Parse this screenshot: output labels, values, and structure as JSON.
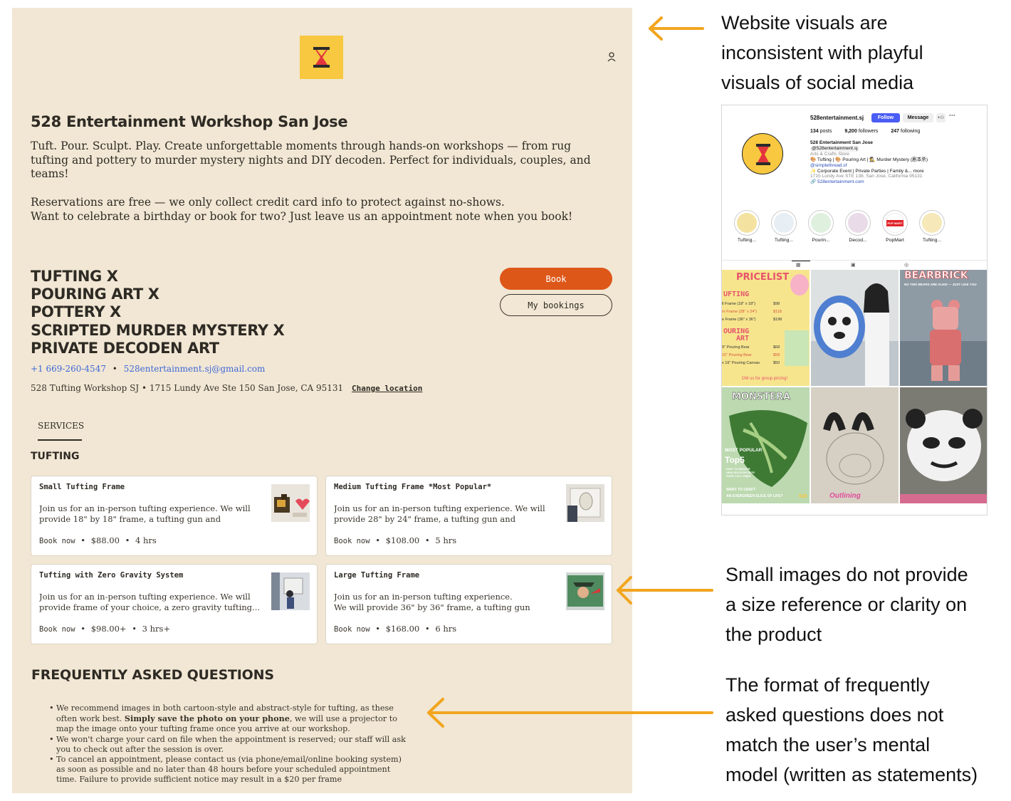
{
  "site": {
    "title": "528 Entertainment Workshop San Jose",
    "intro": "Tuft. Pour. Sculpt. Play. Create unforgettable moments through hands-on workshops — from rug tufting and pottery to murder mystery nights and DIY decoden. Perfect for individuals, couples, and teams!",
    "reservation_line1": "Reservations are free — we only collect credit card info to protect against no-shows.",
    "reservation_line2": "Want to celebrate a birthday or book for two? Just leave us an appointment note when you book!",
    "services_list": [
      "TUFTING X",
      "POURING ART X",
      "POTTERY X",
      "SCRIPTED MURDER MYSTERY X",
      "PRIVATE DECODEN ART"
    ],
    "book_label": "Book",
    "my_bookings_label": "My bookings",
    "phone": "+1 669-260-4547",
    "separator": "•",
    "email": "528entertainment.sj@gmail.com",
    "address": "528 Tufting Workshop SJ • 1715 Lundy Ave Ste 150 San Jose, CA 95131",
    "change_location": "Change location",
    "tab_services": "SERVICES",
    "category": "TUFTING",
    "cards": [
      {
        "title": "Small Tufting Frame",
        "desc": "Join us for an in-person tufting experience. We will provide 18\" by 18\" frame, a tufting gun and unlimited...",
        "book": "Book now",
        "price": "$88.00",
        "duration": "4 hrs"
      },
      {
        "title": "Medium Tufting Frame *Most Popular*",
        "desc": "Join us for an in-person tufting experience. We will provide 28\" by 24\" frame, a tufting gun and unlimited...",
        "book": "Book now",
        "price": "$108.00",
        "duration": "5 hrs"
      },
      {
        "title": "Tufting with Zero Gravity System",
        "desc": "Join us for an in-person tufting experience. We will provide frame of your choice, a zero gravity tufting...",
        "book": "Book now",
        "price": "$98.00+",
        "duration": "3 hrs+"
      },
      {
        "title": "Large Tufting Frame",
        "desc": "Join us for an in-person tufting experience.\nWe will provide 36\" by 36\" frame, a tufting gun and...",
        "book": "Book now",
        "price": "$168.00",
        "duration": "6 hrs"
      }
    ],
    "faq_title": "FREQUENTLY ASKED QUESTIONS",
    "faq": {
      "item1_a": "We recommend images in both cartoon-style and abstract-style for tufting, as these often work best. ",
      "item1_bold": "Simply save the photo on your phone",
      "item1_b": ", we will use a projector to map the image onto your tufting frame once you arrive at our workshop.",
      "item2": "We won't charge your card on file when the appointment is reserved; our staff will ask you to check out after the session is over.",
      "item3": "To cancel an appointment, please contact us (via phone/email/online booking system) as soon as possible and no later than 48 hours before your scheduled appointment time. Failure to provide sufficient notice may result in a $20 per frame"
    }
  },
  "annotations": {
    "a1": [
      "Website visuals are",
      "inconsistent with playful",
      "visuals of social media"
    ],
    "a2": [
      "Small images do not provide",
      "a size reference or clarity on",
      "the product"
    ],
    "a3": [
      "The format of frequently",
      "asked questions does not",
      "match the user’s mental",
      "model (written as statements)"
    ],
    "arrow_color": "#f2a51e"
  },
  "instagram": {
    "username": "528entertainment.sj",
    "follow": "Follow",
    "message": "Message",
    "add_icon": "+⚇",
    "more": "···",
    "posts_num": "134",
    "posts_lbl": "posts",
    "followers_num": "9,200",
    "followers_lbl": "followers",
    "following_num": "247",
    "following_lbl": "following",
    "name": "528 Entertainment San Jose",
    "handle": "@528entertainment.sj",
    "category": "Arts & Crafts Store",
    "bio1": "🎨 Tufting | 🎨 Pouring Art | 🕵 Murder Mystery (剧本杀)",
    "bio2": "@simplethread.sf",
    "bio3": "✨ Corporate Event | Private Parties | Family &... more",
    "bio4": "1715 Lundy Ave STE 138, San Jose, California 95131",
    "link": "🔗 528entertainment.com",
    "highlights": [
      "Tufting...",
      "Tufting...",
      "Pourin...",
      "Decod...",
      "PopMart",
      "Tufting..."
    ],
    "popmart_badge": "POP MART",
    "tab_icons": [
      "▦",
      "▣",
      "◎"
    ],
    "posts": [
      {
        "text": "PRICELIST"
      },
      {
        "text": ""
      },
      {
        "text": "BEARBRICK"
      },
      {
        "text": "MONSTERA"
      },
      {
        "text": ""
      },
      {
        "text": ""
      }
    ],
    "pricelist": {
      "tufting": "UFTING",
      "row1": "ll Frame (18\" x 18\")",
      "p1": "$98",
      "row2": "m Frame (28\" x 24\")",
      "p2": "$118",
      "row3": "e Frame (36\" x 36\")",
      "p3": "$198",
      "pouring": "OURING",
      "art": "ART",
      "row4": "9\" Pouring Bear",
      "p4": "$68",
      "row5": "15\" Pouring Bear",
      "p5": "$58",
      "row6": "x 16\" Pouring Canvas",
      "p6": "$50",
      "dm": "DM us for group pricing!"
    },
    "bearbrick_sub": "NO TWO BEARS ARE ALIKE — JUST LIKE YOU",
    "monstera": {
      "mp": "MOST POPULAR",
      "top5": "Top5",
      "small1": "EASY TO MASTER",
      "small2": "HIGH SUCCESS RATE",
      "small3": "PURE COZY VIBES",
      "craft": "WANT TO CRAFT",
      "slice": "AN EVERGREEN SLICE OF LIFE?",
      "brand": "528"
    },
    "outline_text": "Outlining"
  }
}
